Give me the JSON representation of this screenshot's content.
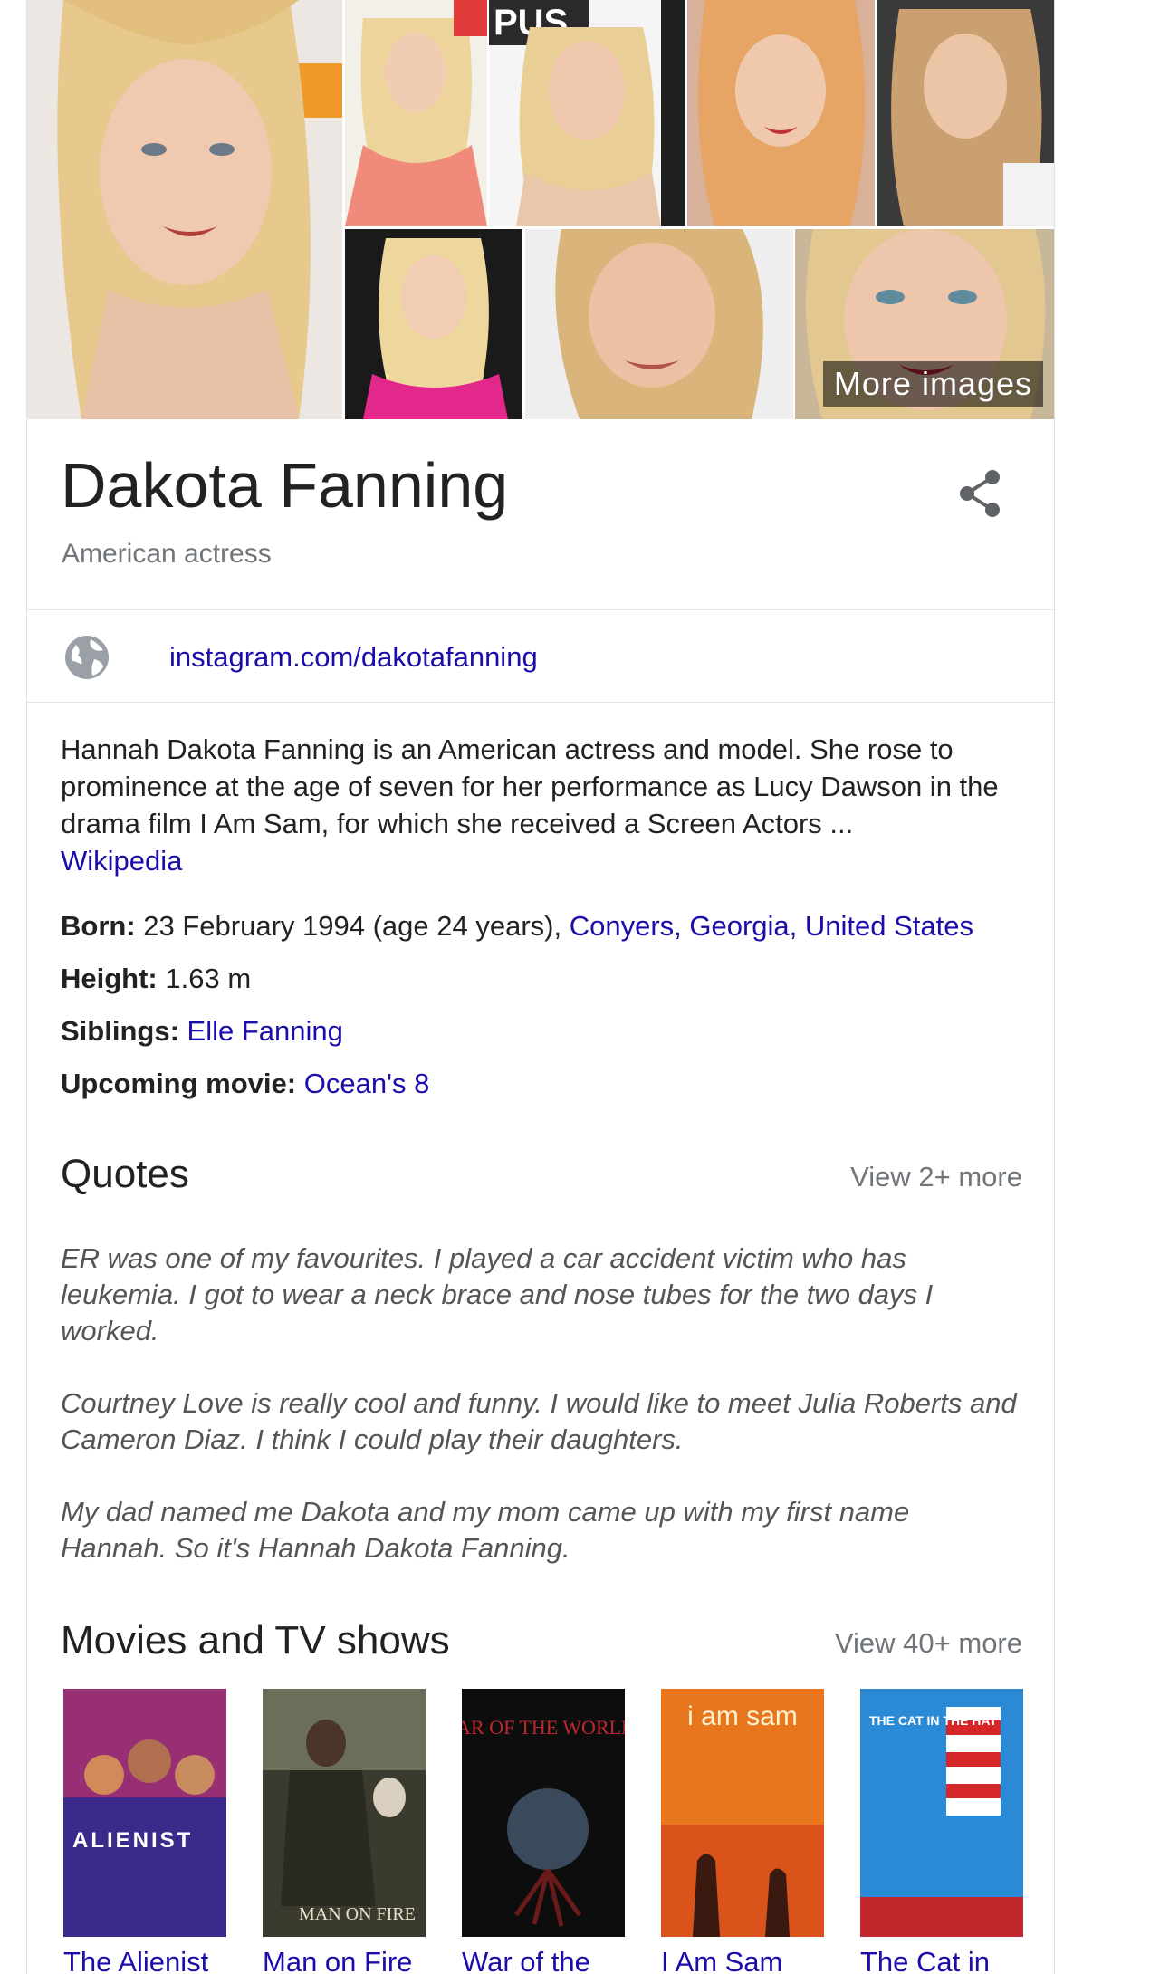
{
  "images": {
    "more_images_label": "More images"
  },
  "entity": {
    "name": "Dakota Fanning",
    "subtitle": "American actress",
    "website": "instagram.com/dakotafanning"
  },
  "description": {
    "text": "Hannah Dakota Fanning is an American actress and model. She rose to prominence at the age of seven for her performance as Lucy Dawson in the drama film I Am Sam, for which she received a Screen Actors ...",
    "source_label": "Wikipedia"
  },
  "facts": {
    "born_label": "Born:",
    "born_value": " 23 February 1994 (age 24 years), ",
    "born_place": "Conyers, Georgia, United States",
    "height_label": "Height:",
    "height_value": " 1.63 m",
    "siblings_label": "Siblings:",
    "siblings_value": "Elle Fanning",
    "upcoming_label": "Upcoming movie:",
    "upcoming_value": "Ocean's 8"
  },
  "quotes": {
    "title": "Quotes",
    "more_label": "View 2+ more",
    "items": [
      "ER was one of my favourites. I played a car accident victim who has leukemia. I got to wear a neck brace and nose tubes for the two days I worked.",
      "Courtney Love is really cool and funny. I would like to meet Julia Roberts and Cameron Diaz. I think I could play their daughters.",
      "My dad named me Dakota and my mom came up with my first name Hannah. So it's Hannah Dakota Fanning."
    ]
  },
  "movies": {
    "title": "Movies and TV shows",
    "more_label": "View 40+ more",
    "items": [
      {
        "title": "The Alienist",
        "poster_text": "ALIENIST",
        "color": "#3b2a8a"
      },
      {
        "title": "Man on Fire",
        "poster_text": "MAN ON FIRE",
        "color": "#3a3a2e"
      },
      {
        "title": "War of the",
        "poster_text": "WAR OF THE WORLDS",
        "color": "#0d0d0d"
      },
      {
        "title": "I Am Sam",
        "poster_text": "i am sam",
        "color": "#e8761f"
      },
      {
        "title": "The Cat in",
        "poster_text": "THE CAT IN THE HAT",
        "color": "#2a8ad6"
      }
    ]
  },
  "colors": {
    "link": "#1a0dab",
    "secondary_text": "#70757a",
    "border": "#dfe1e5"
  }
}
